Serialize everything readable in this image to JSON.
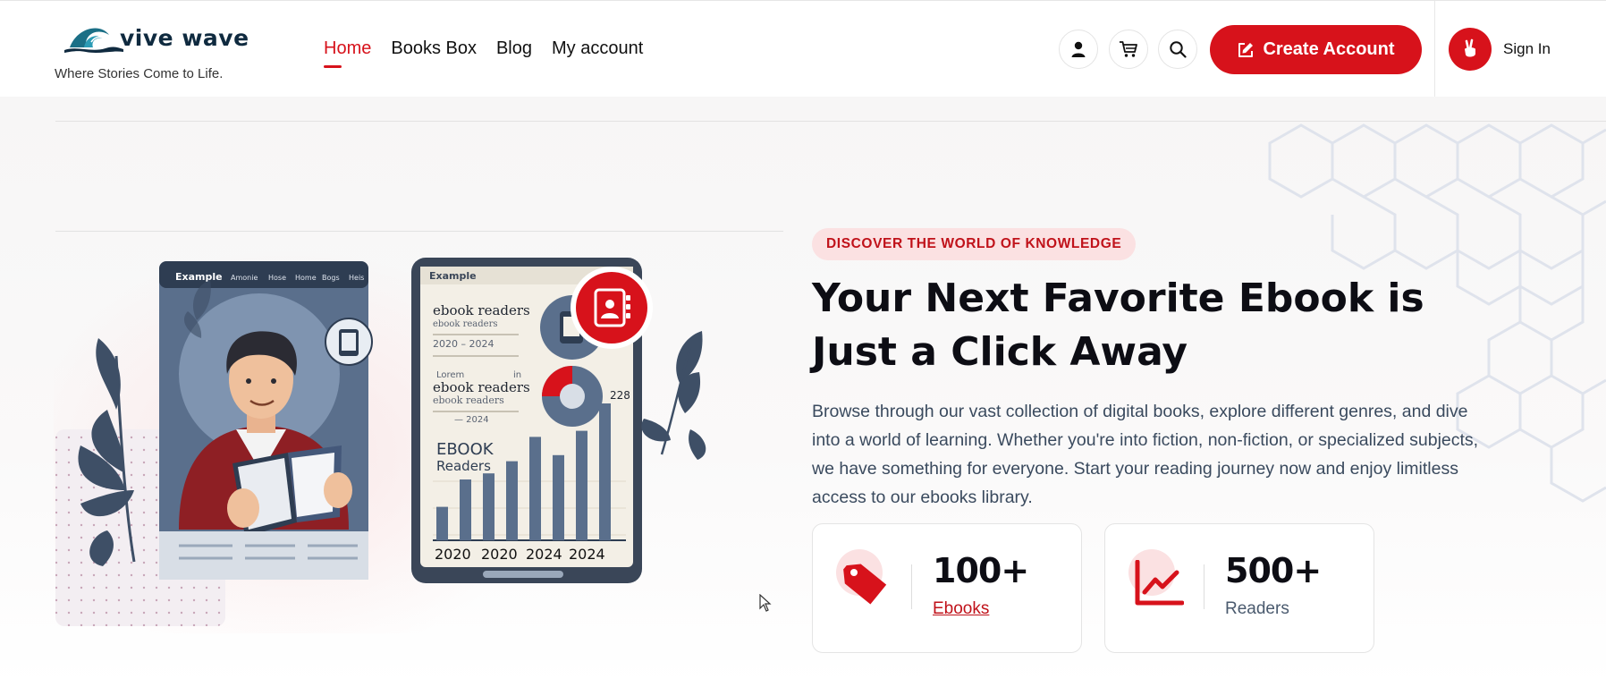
{
  "brand": {
    "name": "vive wave",
    "tagline": "Where Stories Come to Life."
  },
  "nav": {
    "items": [
      {
        "label": "Home",
        "active": true
      },
      {
        "label": "Books Box",
        "active": false
      },
      {
        "label": "Blog",
        "active": false
      },
      {
        "label": "My account",
        "active": false
      }
    ]
  },
  "header_actions": {
    "icons": [
      "user-icon",
      "cart-icon",
      "search-icon"
    ],
    "cta_label": "Create Account",
    "cta_icon": "edit-icon",
    "signin_label": "Sign In",
    "signin_icon": "peace-hand-icon"
  },
  "hero": {
    "eyebrow": "DISCOVER THE WORLD OF KNOWLEDGE",
    "headline": "Your Next Favorite Ebook is Just a Click Away",
    "description": "Browse through our vast collection of digital books, explore different genres, and dive into a world of learning. Whether you're into fiction, non-fiction, or specialized subjects, we have something for everyone. Start your reading journey now and enjoy limitless access to our ebooks library.",
    "illustration": {
      "tablet_left_title": "Example",
      "tablet_left_menu": [
        "Amonie",
        "Hose",
        "Home",
        "Bogs",
        "Heis"
      ],
      "tablet_right_title": "Example",
      "right_heading_1": "ebook readers",
      "right_sub_1": "ebook readers",
      "right_years_1": "2020 – 2024",
      "right_lorem": "Lorem",
      "right_in": "in",
      "right_heading_2": "ebook readers",
      "right_sub_2": "ebook readers",
      "right_years_2": "— 2024",
      "right_value": "228",
      "right_title_big_1": "EBOOK",
      "right_title_big_2": "Readers",
      "bar_values": [
        0.22,
        0.4,
        0.44,
        0.52,
        0.68,
        0.56,
        0.72,
        0.9
      ],
      "chart_year_labels": [
        "2020",
        "2020",
        "2024",
        "2024"
      ]
    }
  },
  "stats": [
    {
      "number": "100+",
      "label": "Ebooks",
      "icon": "price-tag-icon",
      "is_link": true
    },
    {
      "number": "500+",
      "label": "Readers",
      "icon": "trend-chart-icon",
      "is_link": false
    }
  ],
  "colors": {
    "accent": "#d7121b",
    "accent_soft": "#fbe1e2",
    "heading": "#0d0d14",
    "body": "#3a4a5e",
    "brand_navy": "#0f2a3f"
  }
}
